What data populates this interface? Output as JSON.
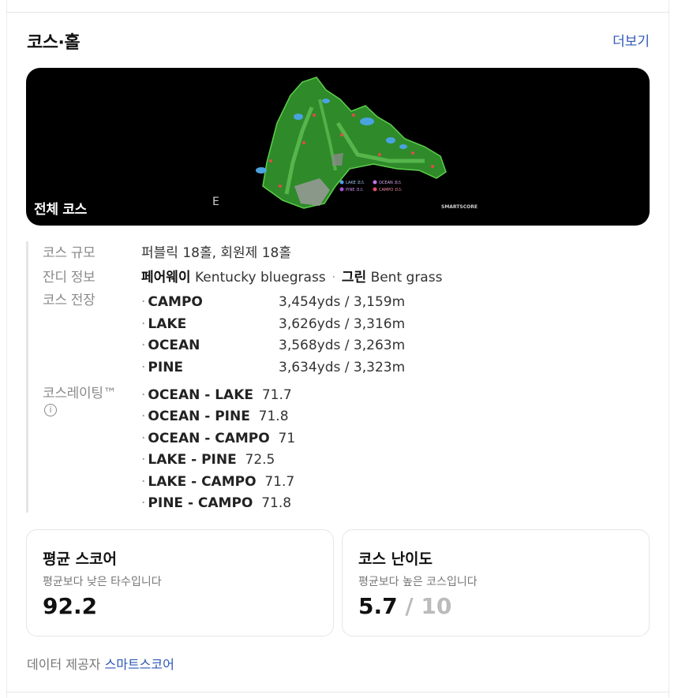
{
  "section": {
    "title": "코스·홀",
    "more": "더보기"
  },
  "map": {
    "caption": "전체 코스",
    "legend": [
      "LAKE 코스",
      "OCEAN 코스",
      "PINE 코스",
      "CAMPO 코스"
    ],
    "brand": "SMARTSCORE"
  },
  "info": {
    "size_label": "코스 규모",
    "size_value": "퍼블릭 18홀, 회원제 18홀",
    "grass_label": "잔디 정보",
    "fairway_label": "페어웨이",
    "fairway_value": "Kentucky bluegrass",
    "green_label": "그린",
    "green_value": "Bent grass",
    "length_label": "코스 전장",
    "lengths": [
      {
        "name": "CAMPO",
        "dist": "3,454yds / 3,159m"
      },
      {
        "name": "LAKE",
        "dist": "3,626yds / 3,316m"
      },
      {
        "name": "OCEAN",
        "dist": "3,568yds / 3,263m"
      },
      {
        "name": "PINE",
        "dist": "3,634yds / 3,323m"
      }
    ],
    "rating_label": "코스레이팅™",
    "ratings": [
      {
        "name": "OCEAN - LAKE",
        "value": "71.7"
      },
      {
        "name": "OCEAN - PINE",
        "value": "71.8"
      },
      {
        "name": "OCEAN - CAMPO",
        "value": "71"
      },
      {
        "name": "LAKE - PINE",
        "value": "72.5"
      },
      {
        "name": "LAKE - CAMPO",
        "value": "71.7"
      },
      {
        "name": "PINE - CAMPO",
        "value": "71.8"
      }
    ]
  },
  "score_card": {
    "title": "평균 스코어",
    "sub": "평균보다 낮은 타수입니다",
    "value": "92.2"
  },
  "difficulty_card": {
    "title": "코스 난이도",
    "sub": "평균보다 높은 코스입니다",
    "value": "5.7",
    "out_of": "/ 10"
  },
  "provider": {
    "label": "데이터 제공자",
    "name": "스마트스코어"
  },
  "colors": {
    "link": "#2e57b6",
    "fairway": "#2f8a2a",
    "map_bg": "#000000"
  }
}
